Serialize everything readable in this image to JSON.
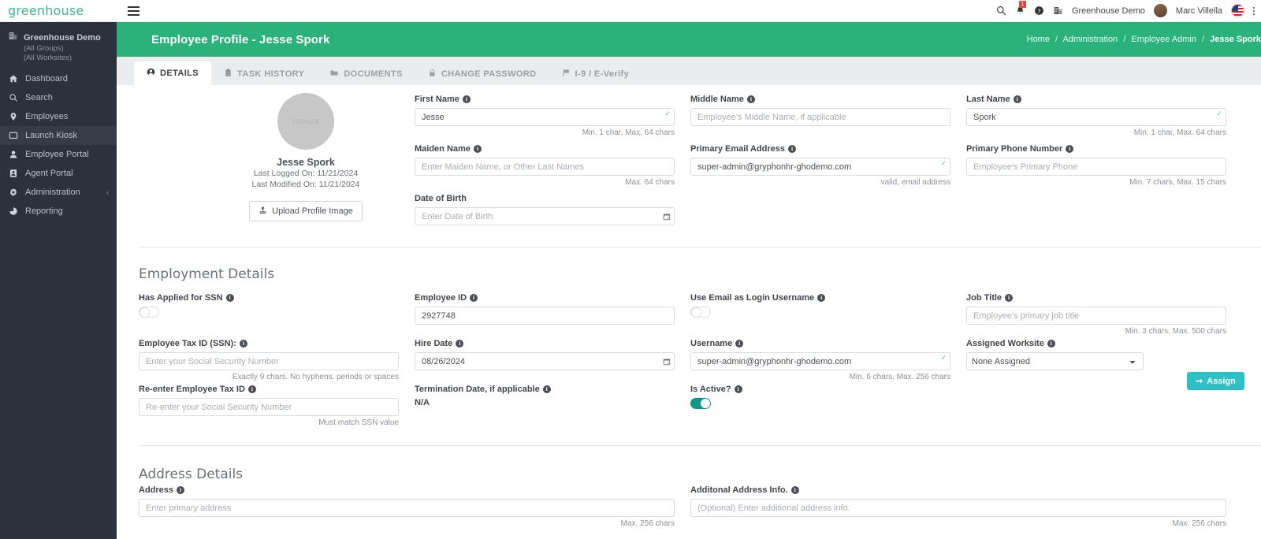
{
  "brand": {
    "logo_text": "greenhouse",
    "accent_green": "#2bb27b",
    "sidebar_bg": "#2b323d",
    "teal": "#2dc1c5"
  },
  "topbar": {
    "menu_icon": "hamburger-icon",
    "search_icon": "search-icon",
    "notification_icon": "bell-icon",
    "notification_count": "1",
    "help_icon": "help-circle-icon",
    "org_icon": "building-icon",
    "org_name": "Greenhouse Demo",
    "user_name": "Marc Villella",
    "flag_icon": "us-flag-icon",
    "kebab_icon": "more-vertical-icon"
  },
  "sidebar": {
    "org": {
      "title": "Greenhouse Demo",
      "sub1": "(All Groups)",
      "sub2": "(All Worksites)"
    },
    "items": [
      {
        "label": "Dashboard",
        "icon": "home-icon",
        "active": false
      },
      {
        "label": "Search",
        "icon": "search-icon",
        "active": false
      },
      {
        "label": "Employees",
        "icon": "map-pin-icon",
        "active": false
      },
      {
        "label": "Launch Kiosk",
        "icon": "monitor-icon",
        "active": true
      },
      {
        "label": "Employee Portal",
        "icon": "user-icon",
        "active": false
      },
      {
        "label": "Agent Portal",
        "icon": "id-card-icon",
        "active": false
      },
      {
        "label": "Administration",
        "icon": "gear-icon",
        "active": false,
        "chevron": "‹"
      },
      {
        "label": "Reporting",
        "icon": "pie-chart-icon",
        "active": false
      }
    ]
  },
  "pagehead": {
    "title": "Employee Profile - Jesse Spork",
    "breadcrumb": [
      {
        "label": "Home",
        "current": false
      },
      {
        "label": "Administration",
        "current": false
      },
      {
        "label": "Employee Admin",
        "current": false
      },
      {
        "label": "Jesse Spork",
        "current": true
      }
    ],
    "separator": "/"
  },
  "tabs": [
    {
      "label": "DETAILS",
      "icon": "user-circle-icon",
      "active": true
    },
    {
      "label": "TASK HISTORY",
      "icon": "clipboard-icon",
      "active": false
    },
    {
      "label": "DOCUMENTS",
      "icon": "folder-icon",
      "active": false
    },
    {
      "label": "CHANGE PASSWORD",
      "icon": "lock-icon",
      "active": false
    },
    {
      "label": "I-9 / E-Verify",
      "icon": "flag-icon",
      "active": false
    }
  ],
  "profile": {
    "placeholder_text": "128×128",
    "name": "Jesse Spork",
    "last_logged": "Last Logged On: 11/21/2024",
    "last_modified": "Last Modified On: 11/21/2024",
    "upload_label": "Upload Profile Image",
    "upload_icon": "upload-icon"
  },
  "details": {
    "first_name": {
      "label": "First Name",
      "value": "Jesse",
      "placeholder": "",
      "hint": "Min. 1 char, Max. 64 chars",
      "valid": true
    },
    "middle_name": {
      "label": "Middle Name",
      "value": "",
      "placeholder": "Employee's Middle Name, if applicable",
      "hint": "",
      "valid": false
    },
    "last_name": {
      "label": "Last Name",
      "value": "Spork",
      "placeholder": "",
      "hint": "Min. 1 char, Max. 64 chars",
      "valid": true
    },
    "maiden_name": {
      "label": "Maiden Name",
      "value": "",
      "placeholder": "Enter Maiden Name, or Other Last Names",
      "hint": "Max. 64 chars",
      "valid": false
    },
    "primary_email": {
      "label": "Primary Email Address",
      "value": "super-admin@gryphonhr-ghodemo.com",
      "placeholder": "",
      "hint": "valid, email address",
      "valid": true
    },
    "primary_phone": {
      "label": "Primary Phone Number",
      "value": "",
      "placeholder": "Employee's Primary Phone",
      "hint": "Min. 7 chars, Max. 15 chars",
      "valid": false
    },
    "date_of_birth": {
      "label": "Date of Birth",
      "value": "",
      "placeholder": "Enter Date of Birth",
      "hint": "",
      "calendar_icon": "calendar-icon"
    }
  },
  "employment": {
    "title": "Employment Details",
    "has_applied_ssn": {
      "label": "Has Applied for SSN",
      "state": "off"
    },
    "employee_id": {
      "label": "Employee ID",
      "value": "2927748",
      "placeholder": "",
      "hint": ""
    },
    "use_email_login": {
      "label": "Use Email as Login Username",
      "state": "off"
    },
    "job_title": {
      "label": "Job Title",
      "value": "",
      "placeholder": "Employee's primary job title",
      "hint": "Min. 3 chars, Max. 500 chars"
    },
    "tax_id": {
      "label": "Employee Tax ID (SSN):",
      "value": "",
      "placeholder": "Enter your Social Security Number",
      "hint": "Exactly 9 chars. No hyphens, periods or spaces"
    },
    "hire_date": {
      "label": "Hire Date",
      "value": "08/26/2024",
      "placeholder": "",
      "calendar_icon": "calendar-icon"
    },
    "username": {
      "label": "Username",
      "value": "super-admin@gryphonhr-ghodemo.com",
      "placeholder": "",
      "hint": "Min. 6 chars, Max. 256 chars",
      "valid": true
    },
    "assigned_worksite": {
      "label": "Assigned Worksite",
      "value": "None Assigned",
      "options": [
        "None Assigned"
      ]
    },
    "assign_button": {
      "label": "Assign",
      "icon": "arrow-right-icon"
    },
    "reenter_tax_id": {
      "label": "Re-enter Employee Tax ID",
      "value": "",
      "placeholder": "Re-enter your Social Security Number",
      "hint": "Must match SSN value"
    },
    "termination_date": {
      "label": "Termination Date, if applicable",
      "value": "N/A"
    },
    "is_active": {
      "label": "Is Active?",
      "state": "on"
    }
  },
  "address": {
    "title": "Address Details",
    "address": {
      "label": "Address",
      "value": "",
      "placeholder": "Enter primary address",
      "hint": "Max. 256 chars"
    },
    "additional": {
      "label": "Additonal Address Info.",
      "value": "",
      "placeholder": "(Optional) Enter additional address info.",
      "hint": "Max. 256 chars"
    }
  }
}
